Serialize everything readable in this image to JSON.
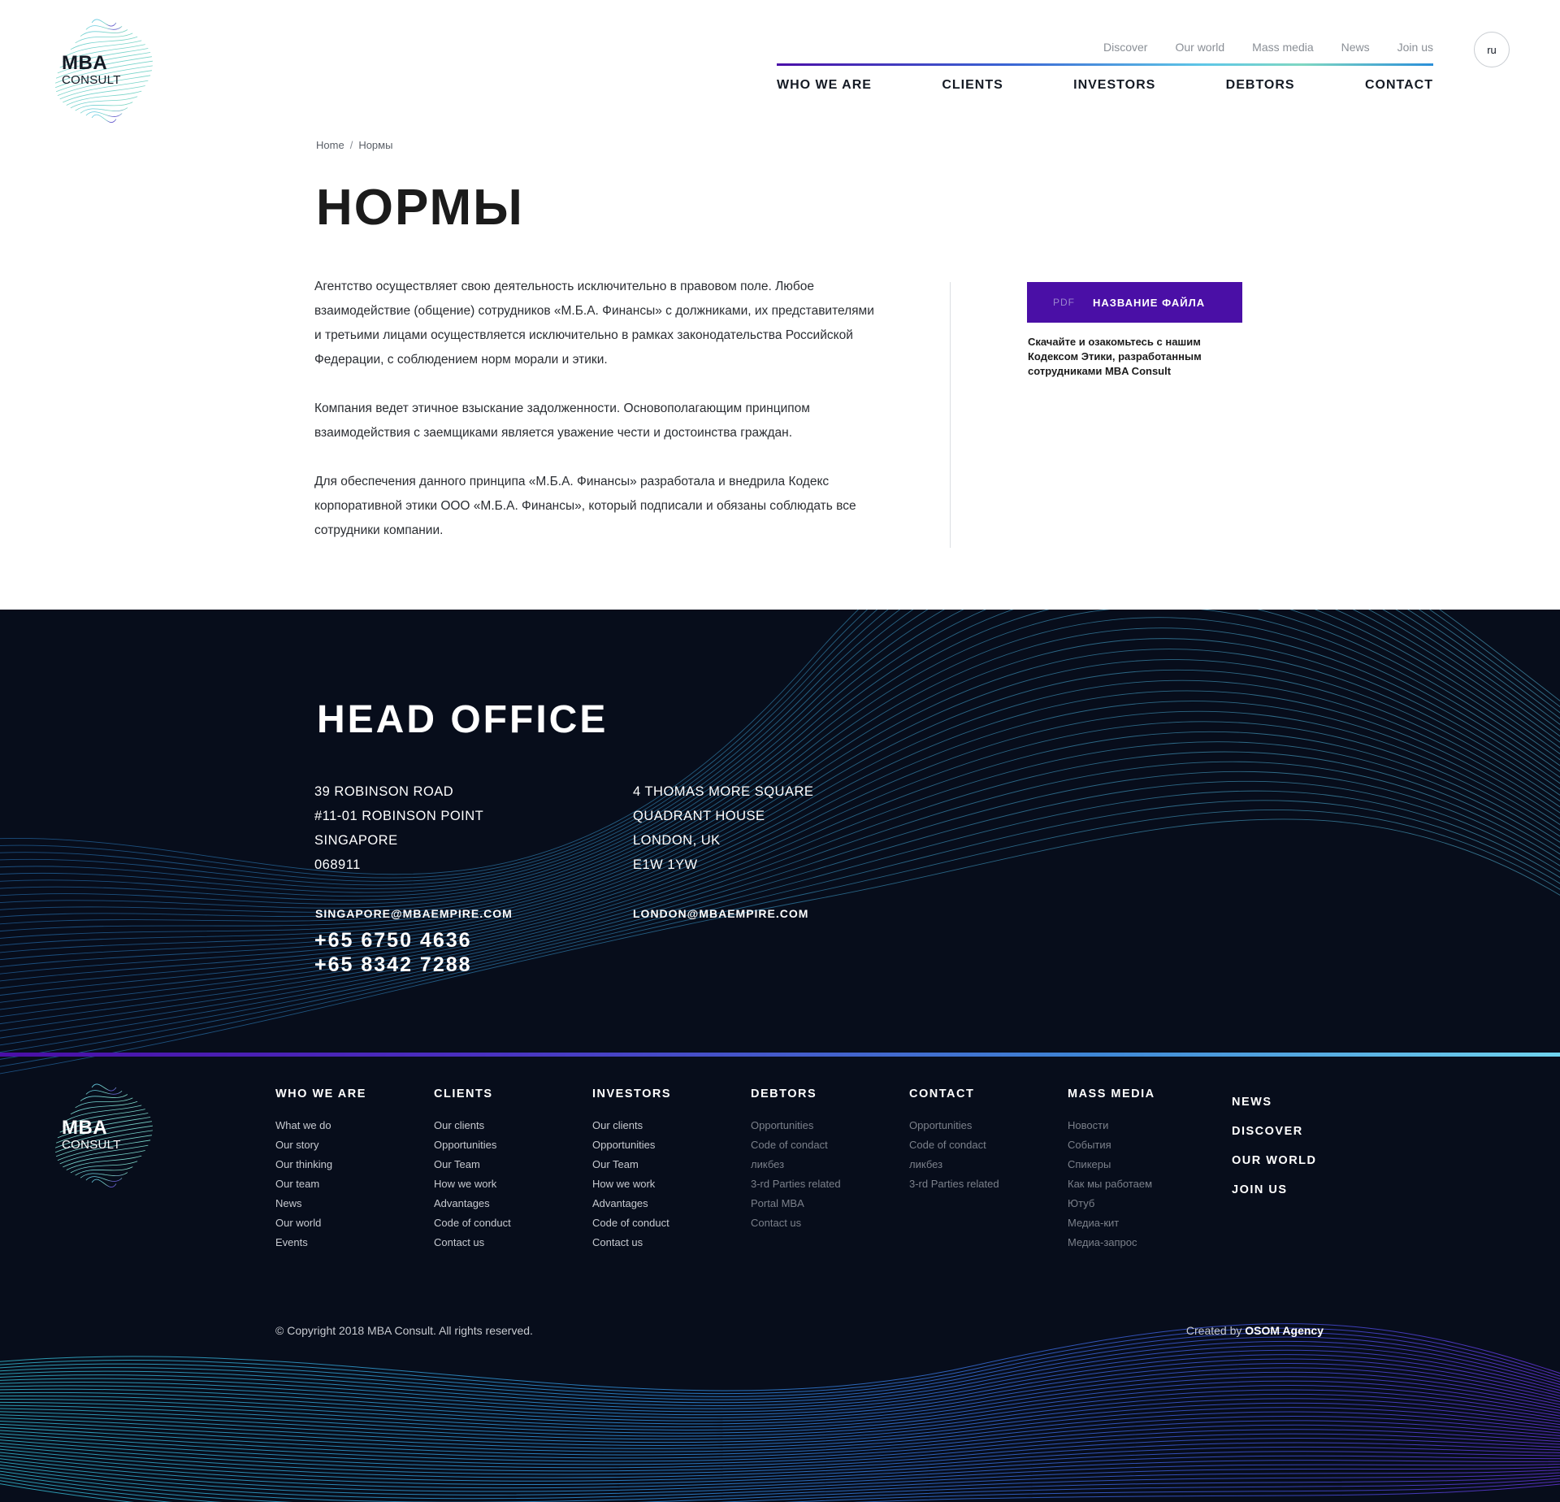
{
  "brand": {
    "name_line1": "MBA",
    "name_line2": "CONSULT"
  },
  "header": {
    "top_links": [
      "Discover",
      "Our world",
      "Mass media",
      "News",
      "Join us"
    ],
    "main_nav": [
      "WHO WE ARE",
      "CLIENTS",
      "INVESTORS",
      "DEBTORS",
      "CONTACT"
    ],
    "language": "ru"
  },
  "breadcrumb": {
    "home": "Home",
    "separator": "/",
    "current": "Нормы"
  },
  "page": {
    "title": "НОРМЫ",
    "paragraphs": [
      "Агентство осуществляет свою деятельность исключительно в правовом поле. Любое взаимодействие (общение) сотрудников «М.Б.А. Финансы» с должниками, их представителями и третьими лицами осуществляется исключительно в рамках законодательства Российской Федерации, с соблюдением норм морали и этики.",
      "Компания ведет этичное взыскание задолженности. Основополагающим принципом взаимодействия с заемщиками является уважение чести и достоинства граждан.",
      "Для обеспечения данного принципа «М.Б.А. Финансы» разработала и внедрила Кодекс корпоративной этики ООО «М.Б.А. Финансы», который подписали и обязаны соблюдать все сотрудники компании."
    ],
    "download": {
      "type_label": "PDF",
      "file_label": "НАЗВАНИЕ ФАЙЛА",
      "note": "Скачайте и озакомьтесь с нашим Кодексом Этики, разработанным сотрудниками MBA Consult"
    }
  },
  "head_office": {
    "title": "HEAD OFFICE",
    "singapore": {
      "lines": [
        "39 ROBINSON ROAD",
        "#11-01 ROBINSON POINT",
        "SINGAPORE",
        "068911"
      ],
      "email": "SINGAPORE@MBAEMPIRE.COM",
      "phones": [
        "+65 6750 4636",
        "+65 8342 7288"
      ]
    },
    "london": {
      "lines": [
        "4 THOMAS MORE SQUARE",
        "QUADRANT HOUSE",
        "LONDON, UK",
        "E1W 1YW"
      ],
      "email": "LONDON@MBAEMPIRE.COM"
    }
  },
  "footer": {
    "columns": [
      {
        "title": "WHO WE ARE",
        "links": [
          "What we do",
          "Our story",
          "Our thinking",
          "Our team",
          "News",
          "Our world",
          "Events"
        ]
      },
      {
        "title": "CLIENTS",
        "links": [
          "Our clients",
          "Opportunities",
          "Our Team",
          "How we work",
          "Advantages",
          "Code of conduct",
          "Contact us"
        ]
      },
      {
        "title": "INVESTORS",
        "links": [
          "Our clients",
          "Opportunities",
          "Our Team",
          "How we work",
          "Advantages",
          "Code of conduct",
          "Contact us"
        ]
      },
      {
        "title": "DEBTORS",
        "links": [
          "Opportunities",
          "Code of condact",
          "ликбез",
          "3-rd Parties related",
          "Portal MBA",
          "Contact us"
        ]
      },
      {
        "title": "CONTACT",
        "links": [
          "Opportunities",
          "Code of condact",
          "ликбез",
          "3-rd Parties related"
        ]
      },
      {
        "title": "MASS MEDIA",
        "links": [
          "Новости",
          "События",
          "Спикеры",
          "Как мы работаем",
          "Ютуб",
          "Медиа-кит",
          "Медиа-запрос"
        ]
      }
    ],
    "right_links": [
      "NEWS",
      "DISCOVER",
      "OUR WORLD",
      "JOIN US"
    ],
    "copyright": "© Copyright 2018 MBA Consult. All rights reserved.",
    "created_by_prefix": "Created by",
    "created_by_name": "OSOM Agency"
  },
  "colors": {
    "accent": "#4a0fa6",
    "dark_bg": "#070d1b",
    "gradient_start": "#4b0fa8",
    "gradient_end": "#6fd3ee"
  }
}
